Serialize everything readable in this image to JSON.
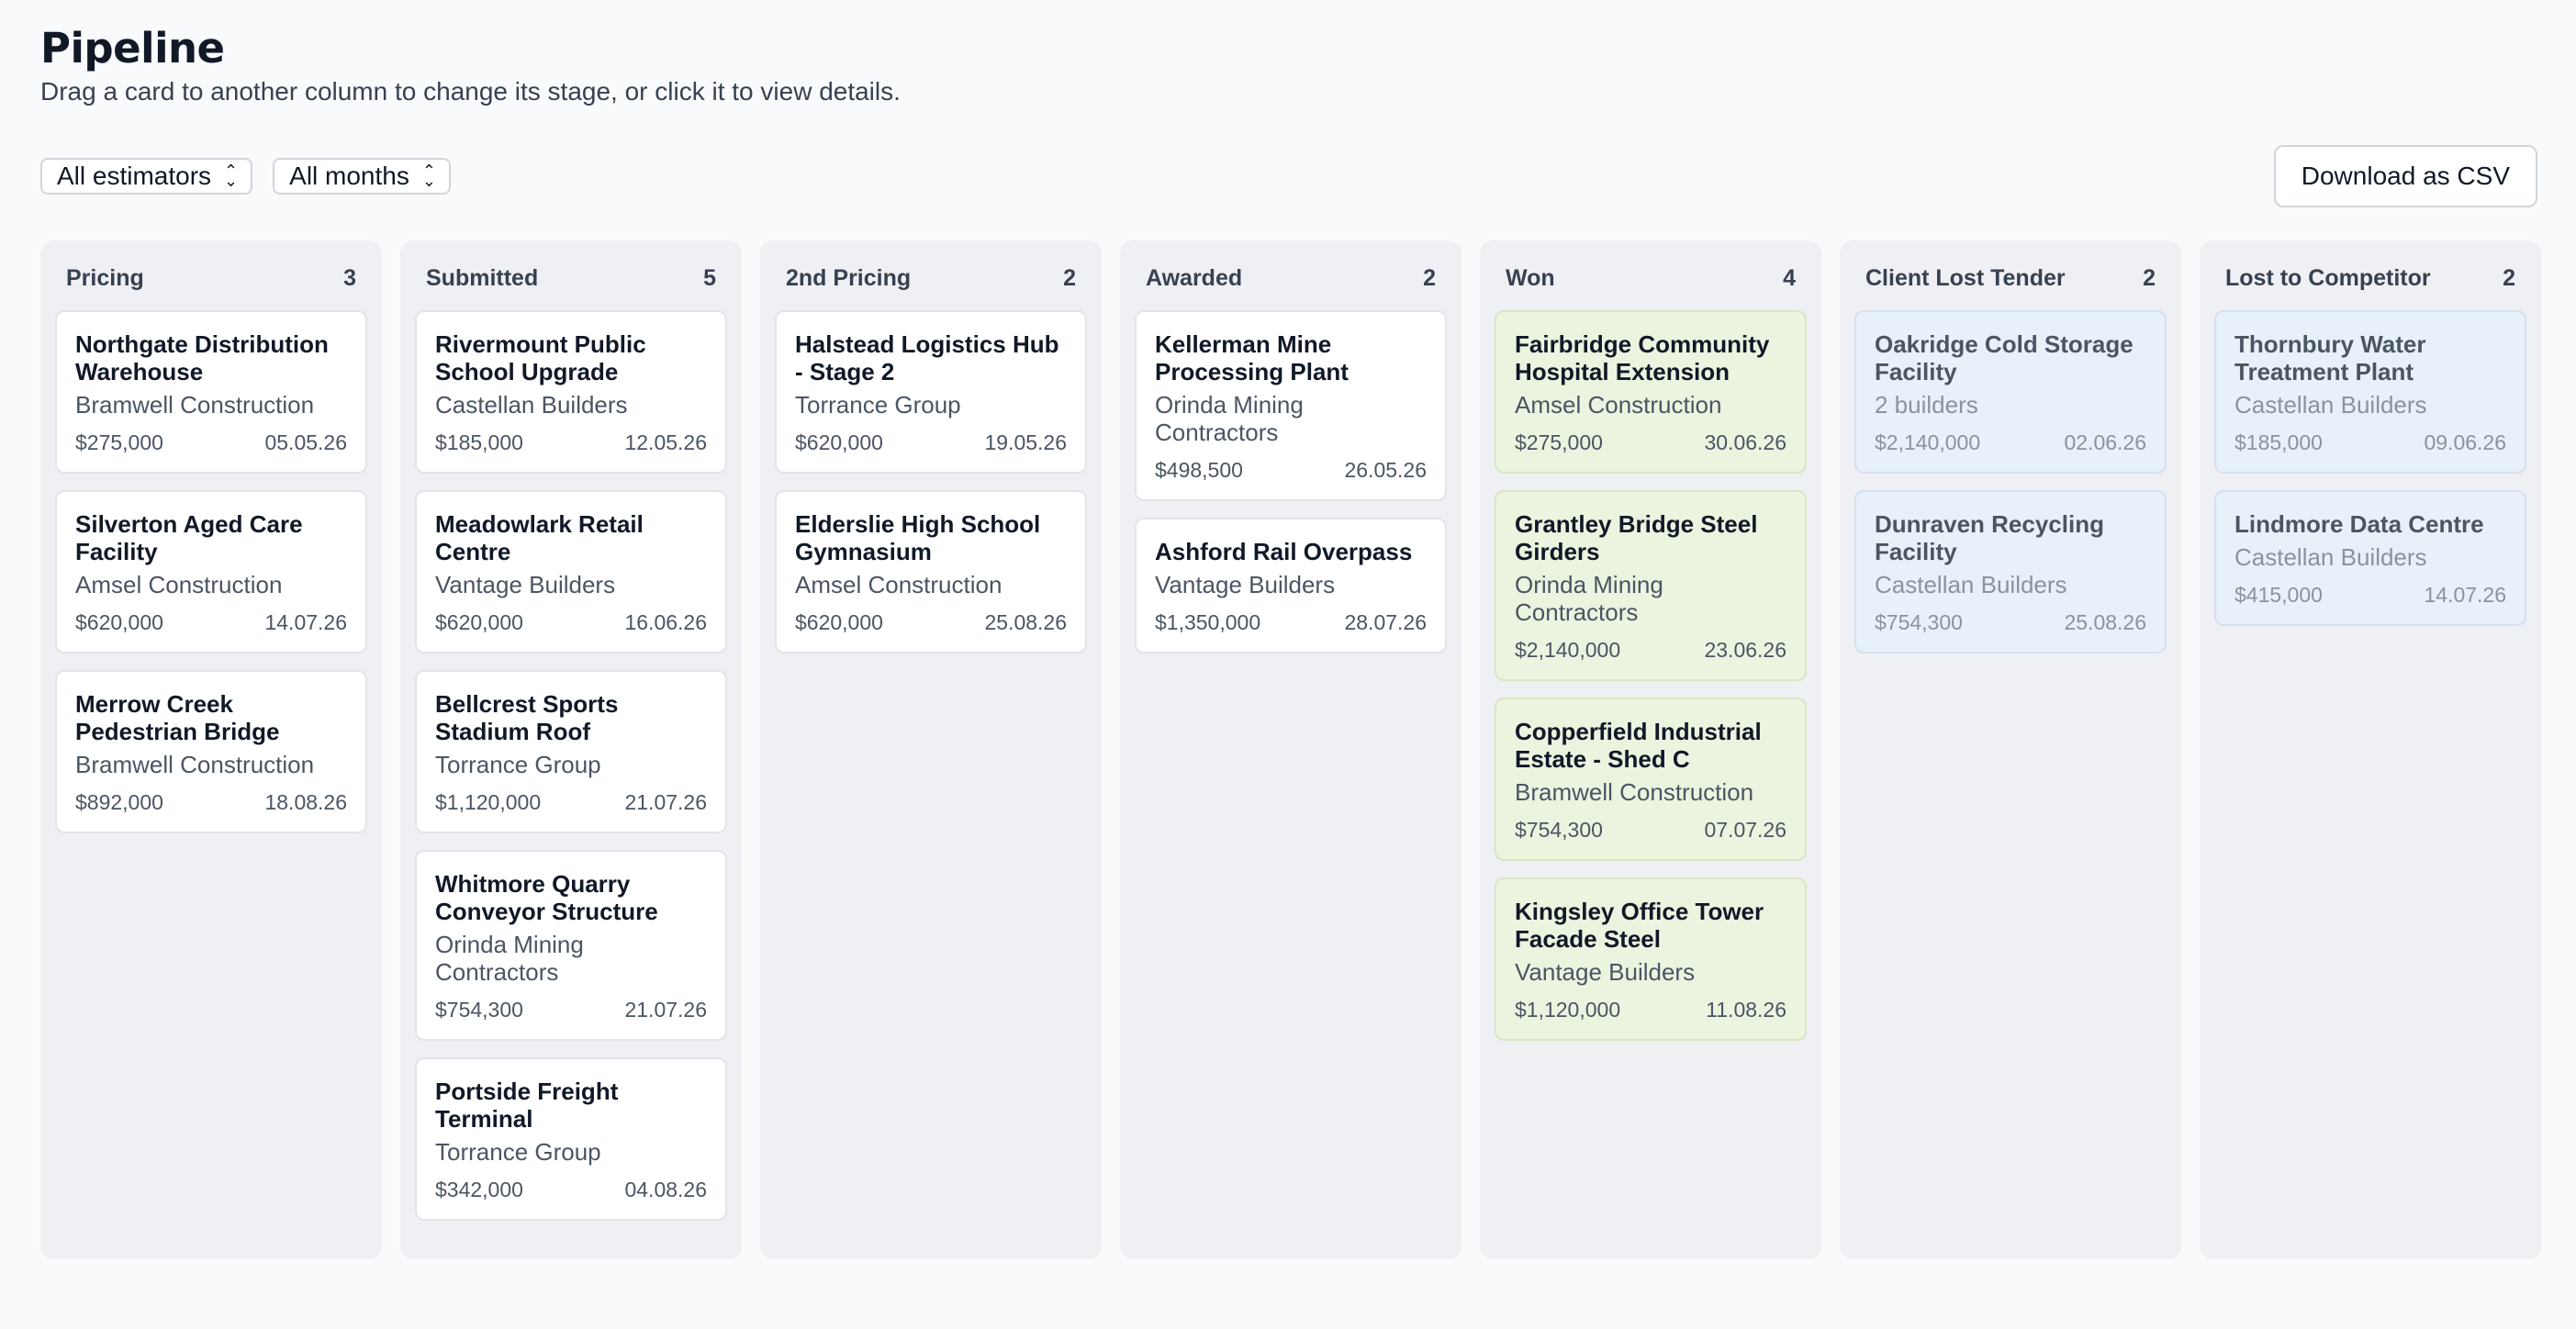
{
  "header": {
    "title": "Pipeline",
    "subtitle": "Drag a card to another column to change its stage, or click it to view details."
  },
  "filters": {
    "estimator": "All estimators",
    "month": "All months"
  },
  "actions": {
    "download_csv": "Download as CSV"
  },
  "colors": {
    "won_card": "#ebf4df",
    "lost_card": "#e8f0f9",
    "column_bg": "#eff0f3"
  },
  "columns": [
    {
      "title": "Pricing",
      "count": "3",
      "variant": "default",
      "cards": [
        {
          "name": "Northgate Distribution Warehouse",
          "builder": "Bramwell Construction",
          "value": "$275,000",
          "date": "05.05.26"
        },
        {
          "name": "Silverton Aged Care Facility",
          "builder": "Amsel Construction",
          "value": "$620,000",
          "date": "14.07.26"
        },
        {
          "name": "Merrow Creek Pedestrian Bridge",
          "builder": "Bramwell Construction",
          "value": "$892,000",
          "date": "18.08.26"
        }
      ]
    },
    {
      "title": "Submitted",
      "count": "5",
      "variant": "default",
      "cards": [
        {
          "name": "Rivermount Public School Upgrade",
          "builder": "Castellan Builders",
          "value": "$185,000",
          "date": "12.05.26"
        },
        {
          "name": "Meadowlark Retail Centre",
          "builder": "Vantage Builders",
          "value": "$620,000",
          "date": "16.06.26"
        },
        {
          "name": "Bellcrest Sports Stadium Roof",
          "builder": "Torrance Group",
          "value": "$1,120,000",
          "date": "21.07.26"
        },
        {
          "name": "Whitmore Quarry Conveyor Structure",
          "builder": "Orinda Mining Contractors",
          "value": "$754,300",
          "date": "21.07.26"
        },
        {
          "name": "Portside Freight Terminal",
          "builder": "Torrance Group",
          "value": "$342,000",
          "date": "04.08.26"
        }
      ]
    },
    {
      "title": "2nd Pricing",
      "count": "2",
      "variant": "default",
      "cards": [
        {
          "name": "Halstead Logistics Hub - Stage 2",
          "builder": "Torrance Group",
          "value": "$620,000",
          "date": "19.05.26"
        },
        {
          "name": "Elderslie High School Gymnasium",
          "builder": "Amsel Construction",
          "value": "$620,000",
          "date": "25.08.26"
        }
      ]
    },
    {
      "title": "Awarded",
      "count": "2",
      "variant": "default",
      "cards": [
        {
          "name": "Kellerman Mine Processing Plant",
          "builder": "Orinda Mining Contractors",
          "value": "$498,500",
          "date": "26.05.26"
        },
        {
          "name": "Ashford Rail Overpass",
          "builder": "Vantage Builders",
          "value": "$1,350,000",
          "date": "28.07.26"
        }
      ]
    },
    {
      "title": "Won",
      "count": "4",
      "variant": "won",
      "cards": [
        {
          "name": "Fairbridge Community Hospital Extension",
          "builder": "Amsel Construction",
          "value": "$275,000",
          "date": "30.06.26"
        },
        {
          "name": "Grantley Bridge Steel Girders",
          "builder": "Orinda Mining Contractors",
          "value": "$2,140,000",
          "date": "23.06.26"
        },
        {
          "name": "Copperfield Industrial Estate - Shed C",
          "builder": "Bramwell Construction",
          "value": "$754,300",
          "date": "07.07.26"
        },
        {
          "name": "Kingsley Office Tower Facade Steel",
          "builder": "Vantage Builders",
          "value": "$1,120,000",
          "date": "11.08.26"
        }
      ]
    },
    {
      "title": "Client Lost Tender",
      "count": "2",
      "variant": "lost",
      "cards": [
        {
          "name": "Oakridge Cold Storage Facility",
          "builder": "2 builders",
          "value": "$2,140,000",
          "date": "02.06.26"
        },
        {
          "name": "Dunraven Recycling Facility",
          "builder": "Castellan Builders",
          "value": "$754,300",
          "date": "25.08.26"
        }
      ]
    },
    {
      "title": "Lost to Competitor",
      "count": "2",
      "variant": "lost",
      "cards": [
        {
          "name": "Thornbury Water Treatment Plant",
          "builder": "Castellan Builders",
          "value": "$185,000",
          "date": "09.06.26"
        },
        {
          "name": "Lindmore Data Centre",
          "builder": "Castellan Builders",
          "value": "$415,000",
          "date": "14.07.26"
        }
      ]
    }
  ]
}
